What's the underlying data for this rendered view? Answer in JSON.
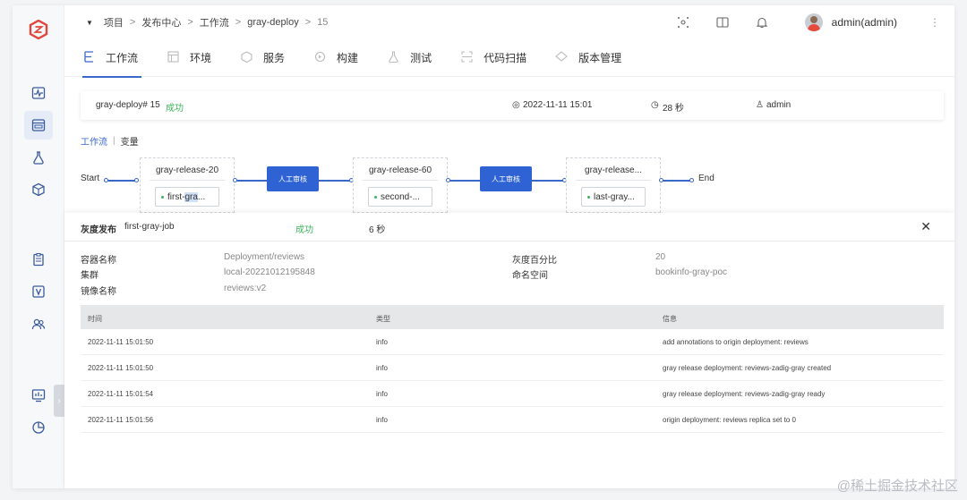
{
  "breadcrumb": {
    "items": [
      "项目",
      "发布中心",
      "工作流",
      "gray-deploy"
    ],
    "current": "15"
  },
  "user": {
    "name": "admin(admin)"
  },
  "tabs": [
    {
      "label": "工作流",
      "icon": "workflow-icon"
    },
    {
      "label": "环境",
      "icon": "environment-icon"
    },
    {
      "label": "服务",
      "icon": "service-icon"
    },
    {
      "label": "构建",
      "icon": "build-icon"
    },
    {
      "label": "测试",
      "icon": "test-icon"
    },
    {
      "label": "代码扫描",
      "icon": "scan-icon"
    },
    {
      "label": "版本管理",
      "icon": "version-icon"
    }
  ],
  "summary": {
    "task": "gray-deploy# 15",
    "status": "成功",
    "time": "2022-11-11 15:01",
    "duration": "28 秒",
    "user": "admin"
  },
  "subtabs": {
    "workflow": "工作流",
    "variables": "变量"
  },
  "flow": {
    "start": "Start",
    "end": "End",
    "stages": [
      {
        "title": "gray-release-20",
        "job": "first-gra..."
      },
      {
        "title": "gray-release-60",
        "job": "second-..."
      },
      {
        "title": "gray-release...",
        "job": "last-gray..."
      }
    ],
    "approval_label": "人工审核"
  },
  "detail": {
    "title": "灰度发布",
    "job_name": "first-gray-job",
    "status": "成功",
    "duration": "6 秒",
    "fields": {
      "container_label": "容器名称",
      "container_value": "Deployment/reviews",
      "cluster_label": "集群",
      "cluster_value": "local-20221012195848",
      "image_label": "镜像名称",
      "image_value": "reviews:v2",
      "percent_label": "灰度百分比",
      "percent_value": "20",
      "namespace_label": "命名空间",
      "namespace_value": "bookinfo-gray-poc"
    },
    "log_headers": [
      "时间",
      "类型",
      "信息"
    ],
    "log_rows": [
      [
        "2022-11-11 15:01:50",
        "info",
        "add annotations to origin deployment: reviews"
      ],
      [
        "2022-11-11 15:01:50",
        "info",
        "gray release deployment: reviews-zadig-gray created"
      ],
      [
        "2022-11-11 15:01:54",
        "info",
        "gray release deployment: reviews-zadig-gray ready"
      ],
      [
        "2022-11-11 15:01:56",
        "info",
        "origin deployment: reviews replica set to 0"
      ]
    ]
  },
  "watermark": "@稀土掘金技术社区",
  "colors": {
    "accent": "#3a68c9",
    "success": "#3db45c",
    "approve": "#2f63d4"
  }
}
